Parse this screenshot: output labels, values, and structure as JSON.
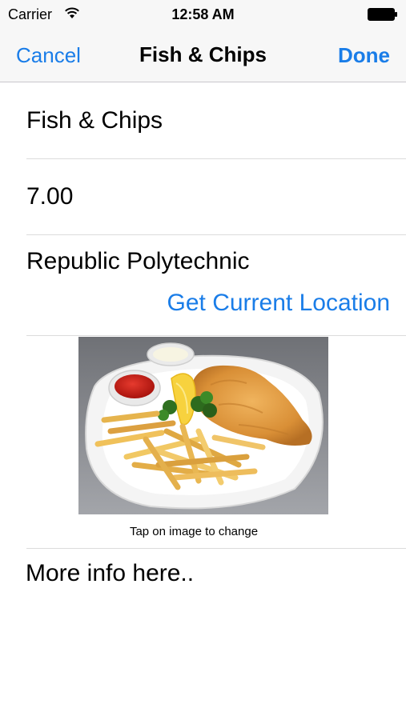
{
  "status_bar": {
    "carrier": "Carrier",
    "time": "12:58 AM",
    "icons": [
      "wifi-icon",
      "battery-icon"
    ]
  },
  "nav": {
    "cancel_label": "Cancel",
    "title": "Fish & Chips",
    "done_label": "Done"
  },
  "form": {
    "name": "Fish & Chips",
    "price": "7.00",
    "location": "Republic Polytechnic",
    "location_button": "Get Current Location",
    "image_caption": "Tap on image to change",
    "notes": "More info here.."
  },
  "colors": {
    "accent": "#1a7de8",
    "bar_background": "#f7f7f7",
    "divider": "#dcdcdc"
  }
}
